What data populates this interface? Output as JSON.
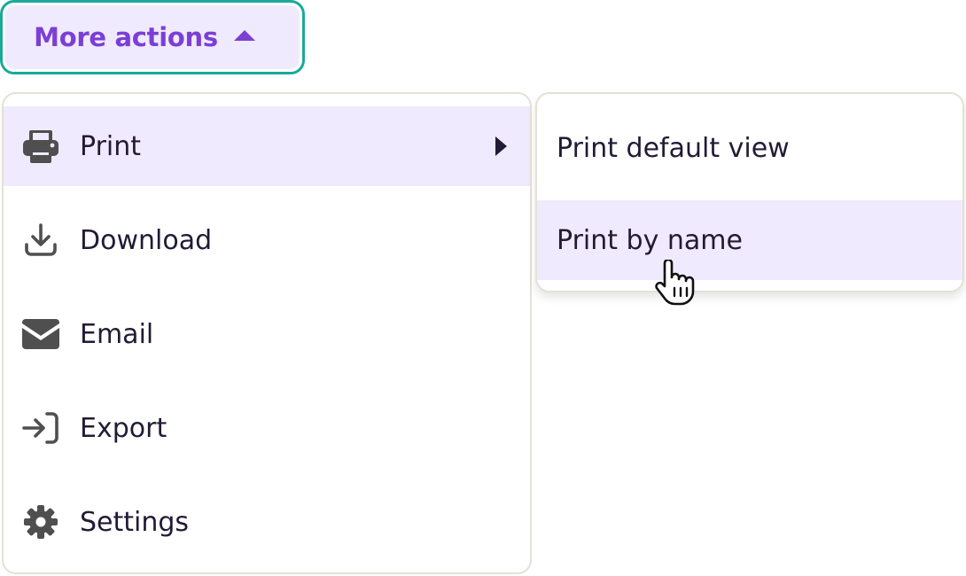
{
  "trigger": {
    "label": "More actions",
    "accent_color": "#7b3fd6",
    "focus_ring_color": "#1ba99b",
    "caret_icon": "caret-up-icon"
  },
  "menu": {
    "items": [
      {
        "label": "Print",
        "icon": "printer-icon",
        "active": true,
        "has_submenu": true
      },
      {
        "label": "Download",
        "icon": "download-icon"
      },
      {
        "label": "Email",
        "icon": "envelope-icon"
      },
      {
        "label": "Export",
        "icon": "export-icon"
      },
      {
        "label": "Settings",
        "icon": "gear-icon"
      }
    ],
    "highlight_color": "#efeafd"
  },
  "submenu": {
    "items": [
      {
        "label": "Print default view"
      },
      {
        "label": "Print by name",
        "hovered": true
      }
    ]
  },
  "cursor": {
    "icon": "hand-pointer-icon"
  }
}
